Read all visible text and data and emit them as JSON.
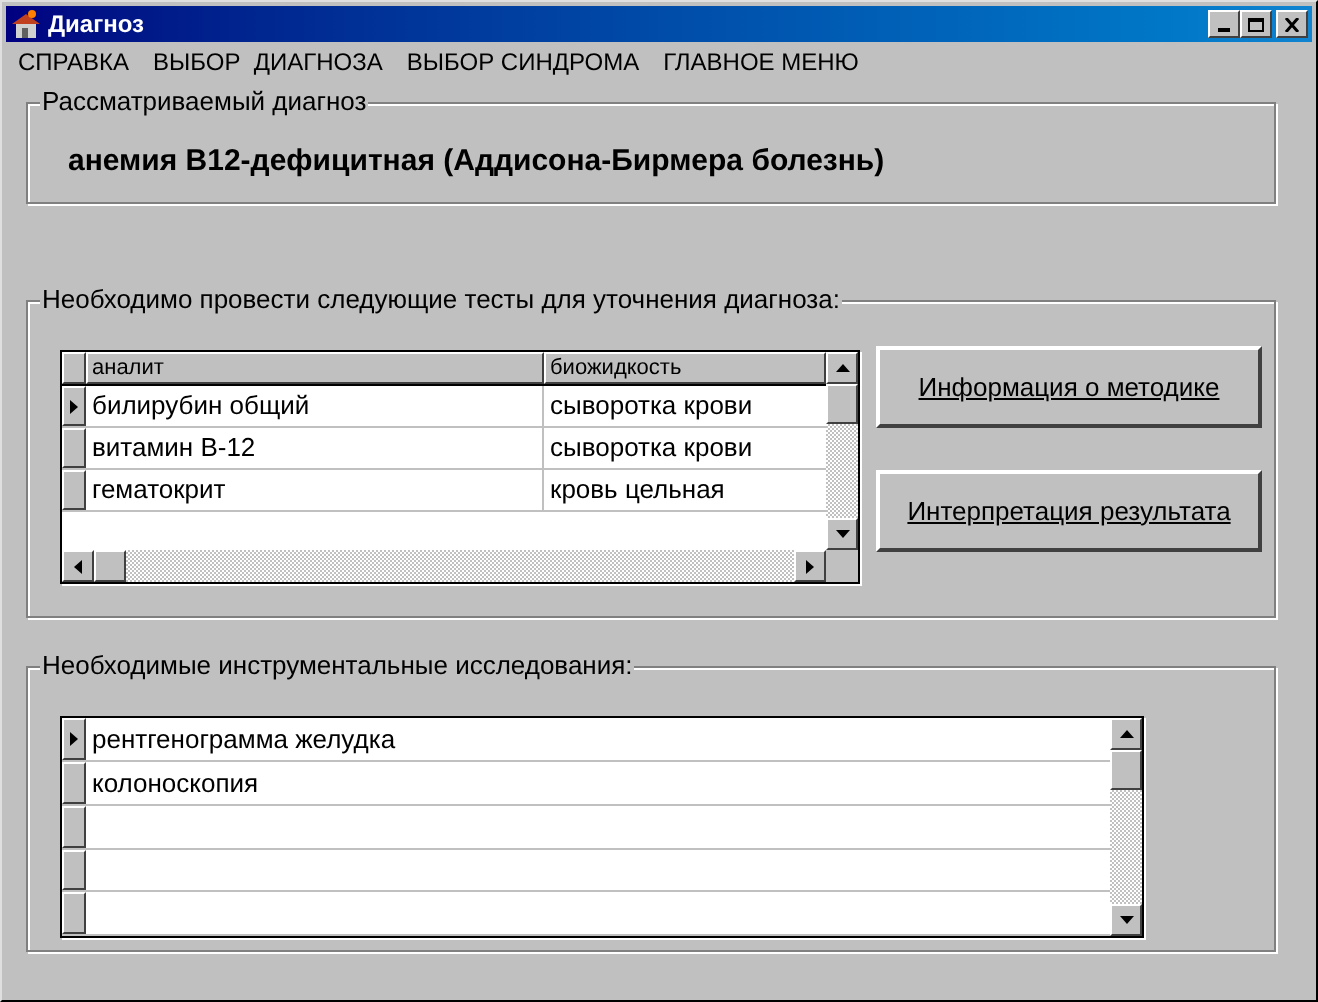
{
  "window": {
    "title": "Диагноз"
  },
  "menu": [
    {
      "label": "СПРАВКА"
    },
    {
      "label": "ВЫБОР  ДИАГНОЗА"
    },
    {
      "label": "ВЫБОР СИНДРОМА"
    },
    {
      "label": "ГЛАВНОЕ МЕНЮ"
    }
  ],
  "diagnosis": {
    "legend": "Рассматриваемый диагноз",
    "value": "анемия В12-дефицитная (Аддисона-Бирмера болезнь)"
  },
  "tests": {
    "legend": "Необходимо провести следующие тесты для уточнения диагноза:",
    "columns": [
      "аналит",
      "биожидкость"
    ],
    "rows": [
      {
        "cells": [
          "билирубин общий",
          "сыворотка крови"
        ],
        "selected": true
      },
      {
        "cells": [
          "витамин В-12",
          "сыворотка крови"
        ],
        "selected": false
      },
      {
        "cells": [
          "гематокрит",
          "кровь цельная"
        ],
        "selected": false
      }
    ],
    "buttons": [
      "Информация о методике",
      "Интерпретация результата"
    ]
  },
  "instrumental": {
    "legend": "Необходимые инструментальные исследования:",
    "rows": [
      {
        "name": "рентгенограмма желудка",
        "selected": true
      },
      {
        "name": "колоноскопия",
        "selected": false
      },
      {
        "selected": false
      },
      {
        "selected": false
      },
      {
        "selected": false
      }
    ]
  }
}
